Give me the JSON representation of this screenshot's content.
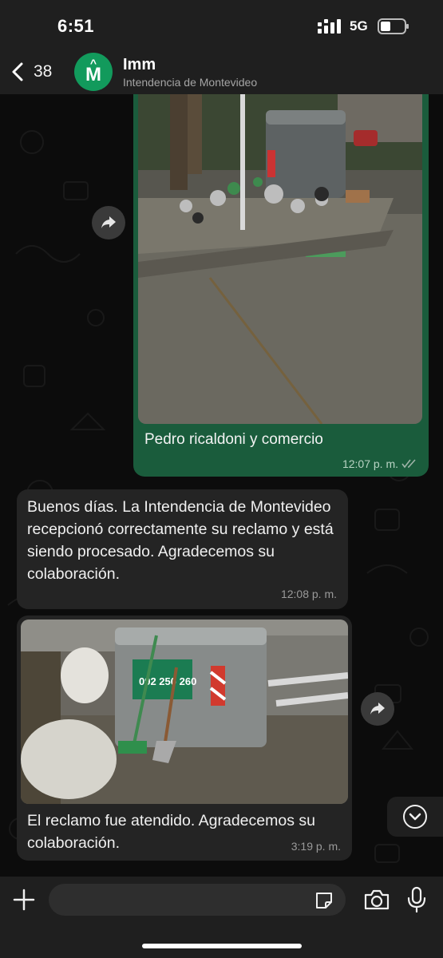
{
  "status_bar": {
    "time": "6:51",
    "network": "5G"
  },
  "header": {
    "back_count": "38",
    "avatar_letter": "M",
    "contact_name": "Imm",
    "contact_subtitle": "Intendencia de Montevideo"
  },
  "messages": [
    {
      "direction": "outgoing",
      "type": "image",
      "caption": "Pedro ricaldoni y comercio",
      "time": "12:07 p. m.",
      "status": "read"
    },
    {
      "direction": "incoming",
      "type": "text",
      "text": "Buenos días. La Intendencia de Montevideo recepcionó correctamente su reclamo y está siendo procesado. Agradecemos su colaboración.",
      "time": "12:08 p. m."
    },
    {
      "direction": "incoming",
      "type": "image",
      "caption": "El reclamo fue atendido. Agradecemos su colaboración.",
      "time": "3:19 p. m.",
      "sign_text": "092 250 260"
    }
  ],
  "input": {
    "placeholder": ""
  },
  "colors": {
    "outgoing_bubble": "#1a5c3c",
    "incoming_bubble": "#242424",
    "avatar": "#129a5c",
    "header": "#1f1f1f"
  },
  "icons": [
    "chevron-left-icon",
    "forward-icon",
    "double-check-icon",
    "chevron-down-icon",
    "plus-icon",
    "sticker-icon",
    "camera-icon",
    "microphone-icon",
    "signal-icon",
    "battery-icon"
  ]
}
